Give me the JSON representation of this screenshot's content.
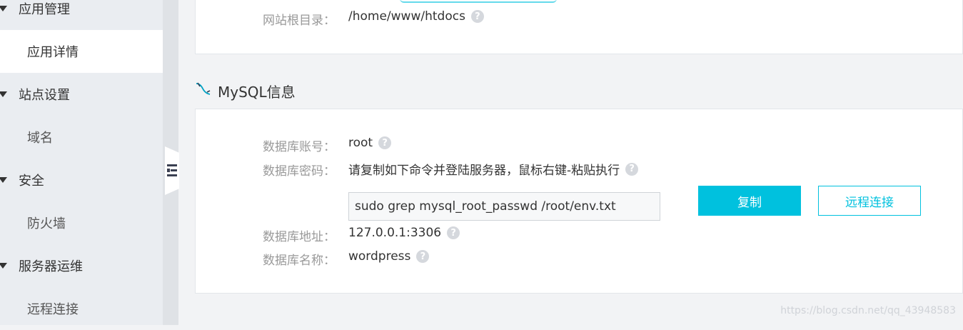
{
  "sidebar": {
    "groups": [
      {
        "label": "应用管理",
        "items": [
          {
            "label": "应用详情",
            "active": true
          }
        ]
      },
      {
        "label": "站点设置",
        "items": [
          {
            "label": "域名",
            "active": false
          }
        ]
      },
      {
        "label": "安全",
        "items": [
          {
            "label": "防火墙",
            "active": false
          }
        ]
      },
      {
        "label": "服务器运维",
        "items": [
          {
            "label": "远程连接",
            "active": false
          }
        ]
      }
    ]
  },
  "site_card": {
    "root_dir_label": "网站根目录：",
    "root_dir_value": "/home/www/htdocs"
  },
  "mysql": {
    "title": "MySQL信息",
    "account_label": "数据库账号：",
    "account_value": "root",
    "password_label": "数据库密码：",
    "password_value": "请复制如下命令并登陆服务器，鼠标右键-粘贴执行",
    "command": "sudo grep mysql_root_passwd /root/env.txt",
    "copy_button": "复制",
    "remote_button": "远程连接",
    "address_label": "数据库地址：",
    "address_value": "127.0.0.1:3306",
    "dbname_label": "数据库名称：",
    "dbname_value": "wordpress"
  },
  "help_icon_glyph": "?",
  "watermark": "https://blog.csdn.net/qq_43948583",
  "colors": {
    "accent": "#00c1de",
    "sidebar_bg": "#eaedf1",
    "page_bg": "#f2f3f5"
  }
}
